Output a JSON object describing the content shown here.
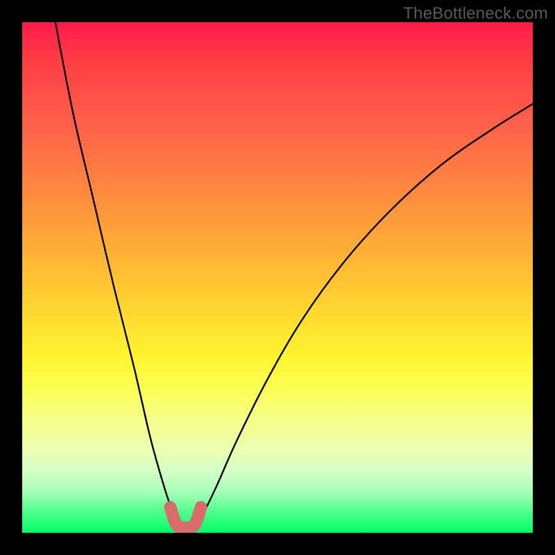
{
  "watermark": "TheBottleneck.com",
  "chart_data": {
    "type": "line",
    "title": "",
    "xlabel": "",
    "ylabel": "",
    "xlim": [
      0,
      100
    ],
    "ylim": [
      0,
      100
    ],
    "gradient_stops": [
      {
        "pos": 0,
        "color": "#ff1a4a"
      },
      {
        "pos": 20,
        "color": "#ff604a"
      },
      {
        "pos": 44,
        "color": "#ffad36"
      },
      {
        "pos": 66,
        "color": "#fff630"
      },
      {
        "pos": 84,
        "color": "#eaffb0"
      },
      {
        "pos": 100,
        "color": "#00ff66"
      }
    ],
    "series": [
      {
        "name": "bottleneck-curve",
        "color": "#000000",
        "x": [
          6.5,
          10,
          14,
          18,
          22,
          25,
          27.5,
          29.5,
          31,
          33,
          35,
          38,
          42,
          48,
          55,
          63,
          72,
          82,
          92,
          100
        ],
        "y": [
          100,
          82,
          65,
          48,
          32,
          19,
          10,
          4,
          1,
          1,
          3,
          9,
          18,
          30,
          42,
          53,
          63,
          72,
          79,
          84
        ]
      },
      {
        "name": "highlight-range",
        "color": "#d96b6b",
        "x": [
          29,
          30,
          31,
          32,
          33,
          34,
          35
        ],
        "y": [
          5,
          2,
          1,
          1,
          1,
          2,
          5
        ]
      }
    ]
  }
}
